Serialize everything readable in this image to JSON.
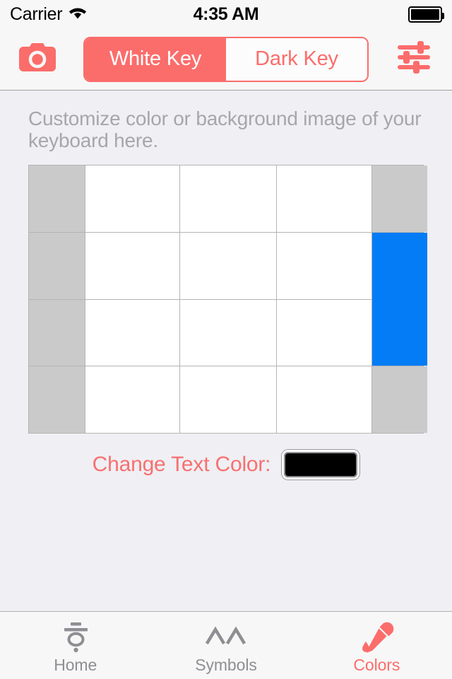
{
  "status_bar": {
    "carrier": "Carrier",
    "wifi_icon": "wifi-icon",
    "time": "4:35 AM",
    "battery_icon": "battery-full-icon",
    "battery_level": 100
  },
  "toolbar": {
    "camera_button": {
      "icon": "camera-icon",
      "color": "#FB6D6B"
    },
    "settings_button": {
      "icon": "sliders-icon",
      "color": "#FB6D6B"
    },
    "segmented_control": {
      "selected_index": 0,
      "segments": [
        {
          "label": "White Key",
          "selected": true
        },
        {
          "label": "Dark Key",
          "selected": false
        }
      ]
    }
  },
  "main": {
    "description": "Customize color or background image of your keyboard here.",
    "keyboard_preview": {
      "columns": 5,
      "rows": 4,
      "cells": [
        {
          "style": "gray"
        },
        {
          "style": "white"
        },
        {
          "style": "white"
        },
        {
          "style": "white"
        },
        {
          "style": "gray"
        },
        {
          "style": "gray"
        },
        {
          "style": "white"
        },
        {
          "style": "white"
        },
        {
          "style": "white"
        },
        {
          "style": "blue",
          "span_rows": 2
        },
        {
          "style": "gray"
        },
        {
          "style": "white"
        },
        {
          "style": "white"
        },
        {
          "style": "white"
        },
        {
          "style": "gray"
        },
        {
          "style": "white"
        },
        {
          "style": "white"
        },
        {
          "style": "white"
        },
        {
          "style": "gray"
        }
      ],
      "key_color": "#FFFFFF",
      "modifier_color": "#CACACA",
      "highlight_color": "#047CF5",
      "grid_line_color": "#B4B4B4"
    },
    "text_color_setting": {
      "label": "Change Text Color:",
      "swatch_color": "#000000",
      "swatch_name": "text-color-swatch"
    }
  },
  "tab_bar": {
    "active_index": 2,
    "items": [
      {
        "label": "Home",
        "icon": "hangul-hieut-icon",
        "active": false
      },
      {
        "label": "Symbols",
        "icon": "double-chevron-up-icon",
        "active": false
      },
      {
        "label": "Colors",
        "icon": "eyedropper-icon",
        "active": true
      }
    ]
  },
  "theme": {
    "accent": "#FB6D6B",
    "background": "#EFEFF4",
    "bar_background": "#F7F7F7",
    "inactive_tab": "#8E8E93",
    "muted_text": "#A6A6AD"
  }
}
